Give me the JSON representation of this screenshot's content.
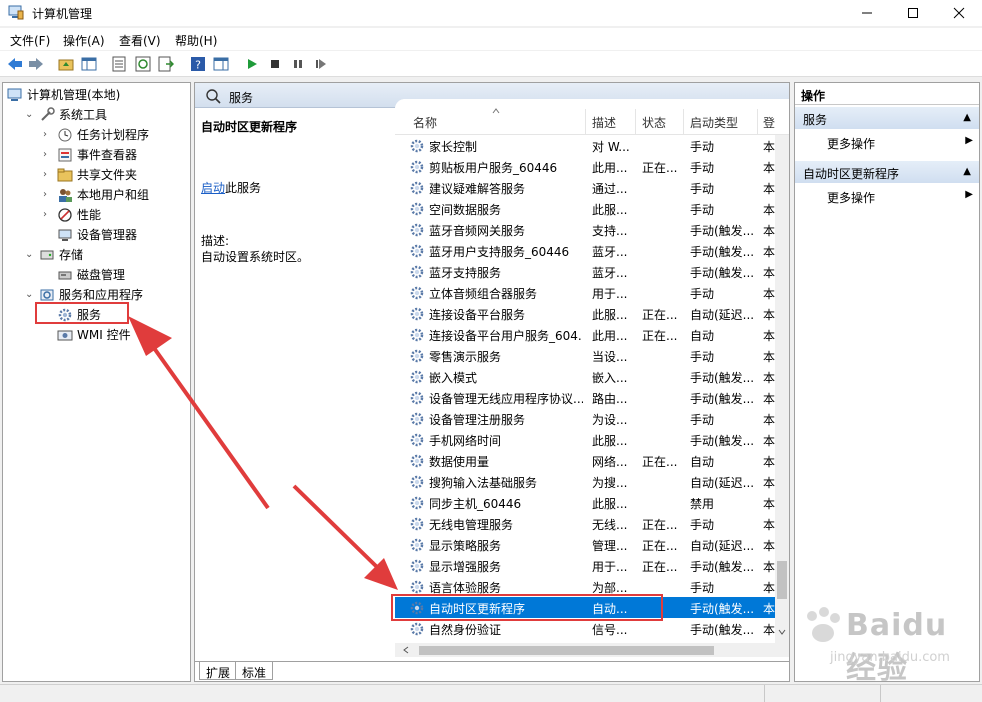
{
  "window": {
    "title": "计算机管理"
  },
  "menu": [
    "文件(F)",
    "操作(A)",
    "查看(V)",
    "帮助(H)"
  ],
  "tree": [
    {
      "label": "计算机管理(本地)",
      "level": 0,
      "expander": "",
      "icon": "computer-icon"
    },
    {
      "label": "系统工具",
      "level": 1,
      "expander": "⌄",
      "icon": "tools-icon"
    },
    {
      "label": "任务计划程序",
      "level": 2,
      "expander": "›",
      "icon": "clock-icon"
    },
    {
      "label": "事件查看器",
      "level": 2,
      "expander": "›",
      "icon": "event-viewer-icon"
    },
    {
      "label": "共享文件夹",
      "level": 2,
      "expander": "›",
      "icon": "folder-icon"
    },
    {
      "label": "本地用户和组",
      "level": 2,
      "expander": "›",
      "icon": "users-icon"
    },
    {
      "label": "性能",
      "level": 2,
      "expander": "›",
      "icon": "performance-icon"
    },
    {
      "label": "设备管理器",
      "level": 2,
      "expander": "",
      "icon": "device-manager-icon"
    },
    {
      "label": "存储",
      "level": 1,
      "expander": "⌄",
      "icon": "storage-icon"
    },
    {
      "label": "磁盘管理",
      "level": 2,
      "expander": "",
      "icon": "disk-icon"
    },
    {
      "label": "服务和应用程序",
      "level": 1,
      "expander": "⌄",
      "icon": "services-apps-icon"
    },
    {
      "label": "服务",
      "level": 2,
      "expander": "",
      "icon": "gear-icon"
    },
    {
      "label": "WMI 控件",
      "level": 2,
      "expander": "",
      "icon": "wmi-icon"
    }
  ],
  "center": {
    "header_title": "服务",
    "selected_title": "自动时区更新程序",
    "start_link": "启动",
    "start_suffix": "此服务",
    "desc_label": "描述:",
    "desc_text": "自动设置系统时区。",
    "columns": {
      "name": "名称",
      "desc": "描述",
      "status": "状态",
      "startup": "启动类型",
      "logon": "登"
    },
    "services": [
      {
        "name": "家长控制",
        "desc": "对 W...",
        "status": "",
        "startup": "手动",
        "logon": "本"
      },
      {
        "name": "剪贴板用户服务_60446",
        "desc": "此用...",
        "status": "正在...",
        "startup": "手动",
        "logon": "本"
      },
      {
        "name": "建议疑难解答服务",
        "desc": "通过...",
        "status": "",
        "startup": "手动",
        "logon": "本"
      },
      {
        "name": "空间数据服务",
        "desc": "此服...",
        "status": "",
        "startup": "手动",
        "logon": "本"
      },
      {
        "name": "蓝牙音频网关服务",
        "desc": "支持...",
        "status": "",
        "startup": "手动(触发...",
        "logon": "本"
      },
      {
        "name": "蓝牙用户支持服务_60446",
        "desc": "蓝牙...",
        "status": "",
        "startup": "手动(触发...",
        "logon": "本"
      },
      {
        "name": "蓝牙支持服务",
        "desc": "蓝牙...",
        "status": "",
        "startup": "手动(触发...",
        "logon": "本"
      },
      {
        "name": "立体音频组合器服务",
        "desc": "用于...",
        "status": "",
        "startup": "手动",
        "logon": "本"
      },
      {
        "name": "连接设备平台服务",
        "desc": "此服...",
        "status": "正在...",
        "startup": "自动(延迟...",
        "logon": "本"
      },
      {
        "name": "连接设备平台用户服务_604...",
        "desc": "此用...",
        "status": "正在...",
        "startup": "自动",
        "logon": "本"
      },
      {
        "name": "零售演示服务",
        "desc": "当设...",
        "status": "",
        "startup": "手动",
        "logon": "本"
      },
      {
        "name": "嵌入模式",
        "desc": "嵌入...",
        "status": "",
        "startup": "手动(触发...",
        "logon": "本"
      },
      {
        "name": "设备管理无线应用程序协议...",
        "desc": "路由...",
        "status": "",
        "startup": "手动(触发...",
        "logon": "本"
      },
      {
        "name": "设备管理注册服务",
        "desc": "为设...",
        "status": "",
        "startup": "手动",
        "logon": "本"
      },
      {
        "name": "手机网络时间",
        "desc": "此服...",
        "status": "",
        "startup": "手动(触发...",
        "logon": "本"
      },
      {
        "name": "数据使用量",
        "desc": "网络...",
        "status": "正在...",
        "startup": "自动",
        "logon": "本"
      },
      {
        "name": "搜狗输入法基础服务",
        "desc": "为搜...",
        "status": "",
        "startup": "自动(延迟...",
        "logon": "本"
      },
      {
        "name": "同步主机_60446",
        "desc": "此服...",
        "status": "",
        "startup": "禁用",
        "logon": "本"
      },
      {
        "name": "无线电管理服务",
        "desc": "无线...",
        "status": "正在...",
        "startup": "手动",
        "logon": "本"
      },
      {
        "name": "显示策略服务",
        "desc": "管理...",
        "status": "正在...",
        "startup": "自动(延迟...",
        "logon": "本"
      },
      {
        "name": "显示增强服务",
        "desc": "用于...",
        "status": "正在...",
        "startup": "手动(触发...",
        "logon": "本"
      },
      {
        "name": "语言体验服务",
        "desc": "为部...",
        "status": "",
        "startup": "手动",
        "logon": "本"
      },
      {
        "name": "自动时区更新程序",
        "desc": "自动...",
        "status": "",
        "startup": "手动(触发...",
        "logon": "本",
        "selected": true
      },
      {
        "name": "自然身份验证",
        "desc": "信号...",
        "status": "",
        "startup": "手动(触发...",
        "logon": "本"
      }
    ],
    "tabs": [
      "扩展",
      "标准"
    ]
  },
  "actions": {
    "title": "操作",
    "section1": "服务",
    "more1": "更多操作",
    "section2": "自动时区更新程序",
    "more2": "更多操作"
  },
  "watermark": {
    "text": "Baidu经验",
    "sub": "jingyan.baidu.com"
  },
  "colors": {
    "accent": "#0078d7",
    "annotation": "#e03c3c",
    "link": "#1a5ec6"
  }
}
